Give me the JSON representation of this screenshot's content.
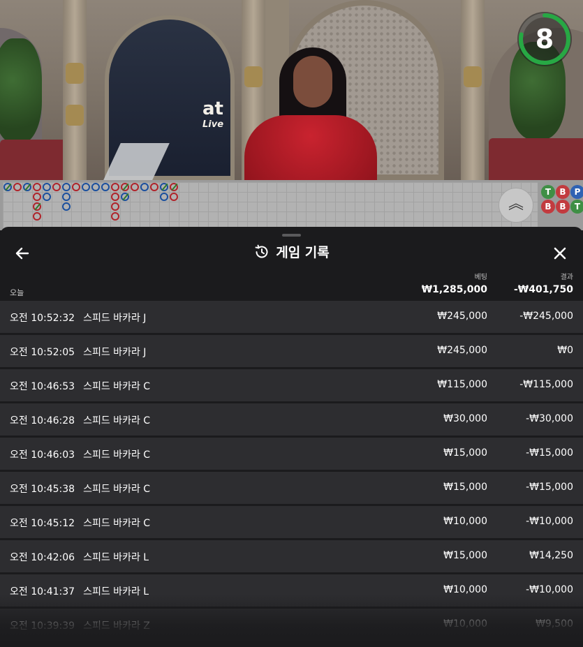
{
  "timer": {
    "seconds": "8",
    "progress": 0.78,
    "color": "#27a844"
  },
  "roadmap": {
    "stats": [
      {
        "label": "T",
        "color": "#3f8f45"
      },
      {
        "label": "B",
        "color": "#c23b3f"
      },
      {
        "label": "P",
        "color": "#2f62b3"
      },
      {
        "label": "B",
        "color": "#c23b3f"
      },
      {
        "label": "B",
        "color": "#c23b3f"
      },
      {
        "label": "T",
        "color": "#3f8f45"
      }
    ]
  },
  "sheet": {
    "title": "게임 기록",
    "today_label": "오늘",
    "bet_header": "베팅",
    "result_header": "결과",
    "total_bet": "₩1,285,000",
    "total_result": "-₩401,750"
  },
  "rows": [
    {
      "time": "오전 10:52:32",
      "game": "스피드 바카라 J",
      "bet": "₩245,000",
      "result": "-₩245,000"
    },
    {
      "time": "오전 10:52:05",
      "game": "스피드 바카라 J",
      "bet": "₩245,000",
      "result": "₩0"
    },
    {
      "time": "오전 10:46:53",
      "game": "스피드 바카라 C",
      "bet": "₩115,000",
      "result": "-₩115,000"
    },
    {
      "time": "오전 10:46:28",
      "game": "스피드 바카라 C",
      "bet": "₩30,000",
      "result": "-₩30,000"
    },
    {
      "time": "오전 10:46:03",
      "game": "스피드 바카라 C",
      "bet": "₩15,000",
      "result": "-₩15,000"
    },
    {
      "time": "오전 10:45:38",
      "game": "스피드 바카라 C",
      "bet": "₩15,000",
      "result": "-₩15,000"
    },
    {
      "time": "오전 10:45:12",
      "game": "스피드 바카라 C",
      "bet": "₩10,000",
      "result": "-₩10,000"
    },
    {
      "time": "오전 10:42:06",
      "game": "스피드 바카라 L",
      "bet": "₩15,000",
      "result": "₩14,250"
    },
    {
      "time": "오전 10:41:37",
      "game": "스피드 바카라 L",
      "bet": "₩10,000",
      "result": "-₩10,000"
    },
    {
      "time": "오전 10:39:39",
      "game": "스피드 바카라 Z",
      "bet": "₩10,000",
      "result": "₩9,500"
    }
  ]
}
